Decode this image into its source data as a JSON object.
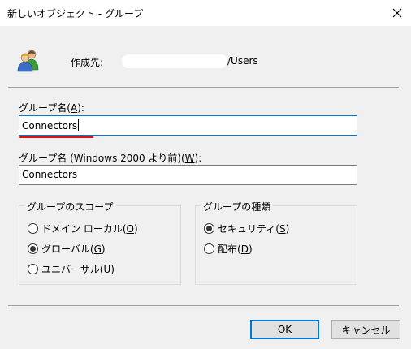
{
  "window": {
    "title": "新しいオブジェクト - グループ",
    "close_icon": "close-icon"
  },
  "header": {
    "icon": "users-group-icon",
    "create_in_label": "作成先:",
    "path_suffix": "/Users"
  },
  "group_name": {
    "label_text": "グループ名(",
    "label_accel": "A",
    "label_end": "):",
    "value": "Connectors"
  },
  "pre2000_name": {
    "label_text": "グループ名 (Windows 2000 より前)(",
    "label_accel": "W",
    "label_end": "):",
    "value": "Connectors"
  },
  "scope": {
    "title": "グループのスコープ",
    "options": [
      {
        "text": "ドメイン ローカル(",
        "accel": "O",
        "end": ")",
        "checked": false
      },
      {
        "text": "グローバル(",
        "accel": "G",
        "end": ")",
        "checked": true
      },
      {
        "text": "ユニバーサル(",
        "accel": "U",
        "end": ")",
        "checked": false
      }
    ]
  },
  "type": {
    "title": "グループの種類",
    "options": [
      {
        "text": "セキュリティ(",
        "accel": "S",
        "end": ")",
        "checked": true
      },
      {
        "text": "配布(",
        "accel": "D",
        "end": ")",
        "checked": false
      }
    ]
  },
  "buttons": {
    "ok": "OK",
    "cancel": "キャンセル"
  },
  "colors": {
    "accent": "#0078d7",
    "annotation_red": "#e01010",
    "dialog_bg": "#f0f0f0"
  }
}
